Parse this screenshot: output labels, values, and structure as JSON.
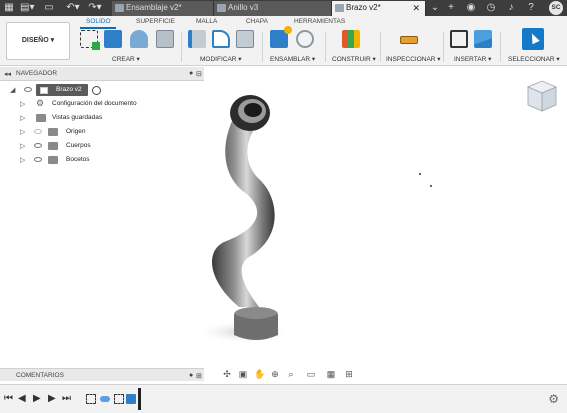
{
  "tabs": [
    {
      "label": "Ensamblaje v2*",
      "active": false
    },
    {
      "label": "Anillo v3",
      "active": false
    },
    {
      "label": "Brazo v2*",
      "active": true
    }
  ],
  "user_initials": "SC",
  "workspace": {
    "label": "DISEÑO ▾"
  },
  "mode_tabs": [
    "SOLIDO",
    "SUPERFICIE",
    "MALLA",
    "CHAPA",
    "HERRAMIENTAS"
  ],
  "toolbar_groups": [
    "CREAR ▾",
    "MODIFICAR ▾",
    "ENSAMBLAR ▾",
    "CONSTRUIR ▾",
    "INSPECCIONAR ▾",
    "INSERTAR ▾",
    "SELECCIONAR ▾"
  ],
  "browser": {
    "title": "NAVEGADOR",
    "root": "Brazo v2",
    "items": [
      "Configuración del documento",
      "Vistas guardadas",
      "Origen",
      "Cuerpos",
      "Bocetos"
    ]
  },
  "comments": {
    "title": "COMENTARIOS"
  },
  "colors": {
    "accent": "#0a6fb8",
    "tabbar": "#3d3d3d",
    "ribbon": "#f2f2f2"
  },
  "icons": [
    "file-icon",
    "save-icon",
    "undo-icon",
    "redo-icon",
    "plus-icon",
    "globe-icon",
    "bell-icon",
    "help-icon",
    "gear-icon"
  ]
}
